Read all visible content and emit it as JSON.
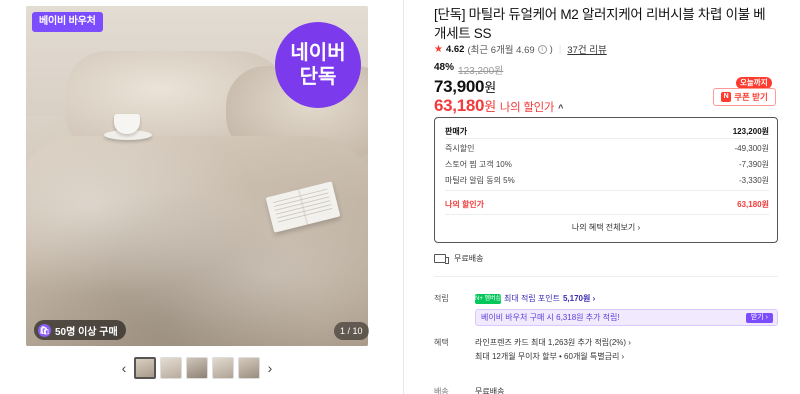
{
  "gallery": {
    "voucher_tag": "베이비 바우처",
    "exclusive_badge_line1": "네이버",
    "exclusive_badge_line2": "단독",
    "buyers_text": "50명 이상 구매",
    "page_indicator": "1 / 10",
    "prev_icon": "chevron-left-icon",
    "next_icon": "chevron-right-icon",
    "thumbnail_count": 5,
    "active_thumbnail": 1
  },
  "product": {
    "title": "[단독] 마틸라 듀얼케어 M2 알러지케어 리버시블 차렵 이불 베개세트 SS",
    "rating": "4.62",
    "rating_detail": "(최근 6개월 4.69",
    "rating_detail_close": ")",
    "reviews_link": "37건 리뷰",
    "discount_rate": "48%",
    "original_price": "123,200원",
    "price_number": "73,900",
    "price_unit": "원",
    "my_price_number": "63,180",
    "my_price_unit": "원",
    "my_price_label": "나의 할인가"
  },
  "coupon": {
    "today_tag": "오늘까지",
    "button_label": "쿠폰 받기",
    "icon": "naver-n-icon"
  },
  "breakdown": {
    "rows": [
      {
        "label": "판매가",
        "value": "123,200원"
      },
      {
        "label": "즉시할인",
        "value": "-49,300원"
      },
      {
        "label": "스토어 찜 고객 10%",
        "value": "-7,390원"
      },
      {
        "label": "마틸라 알림 동의 5%",
        "value": "-3,330원"
      }
    ],
    "my_price_label": "나의 할인가",
    "my_price_value": "63,180원",
    "more_link": "나의 혜택 전체보기 ›"
  },
  "shipping": {
    "text": "무료배송",
    "icon": "truck-icon"
  },
  "points": {
    "label": "적립",
    "np_badge": "N+ 멤버십",
    "max_points_prefix": "최대 적립 포인트",
    "max_points_value": "5,170원 ›",
    "voucher_text": "베이비 바우처 구매 시 6,318원 추가 적립!",
    "voucher_button": "받기 ›"
  },
  "benefits": {
    "label": "혜택",
    "line1": "라인프렌즈 카드 최대 1,263원 추가 적립(2%) ›",
    "line2": "최대 12개월 무이자 할부 • 60개월 특별금리 ›"
  },
  "cutoff": {
    "label": "배송",
    "value": "무료배송"
  }
}
